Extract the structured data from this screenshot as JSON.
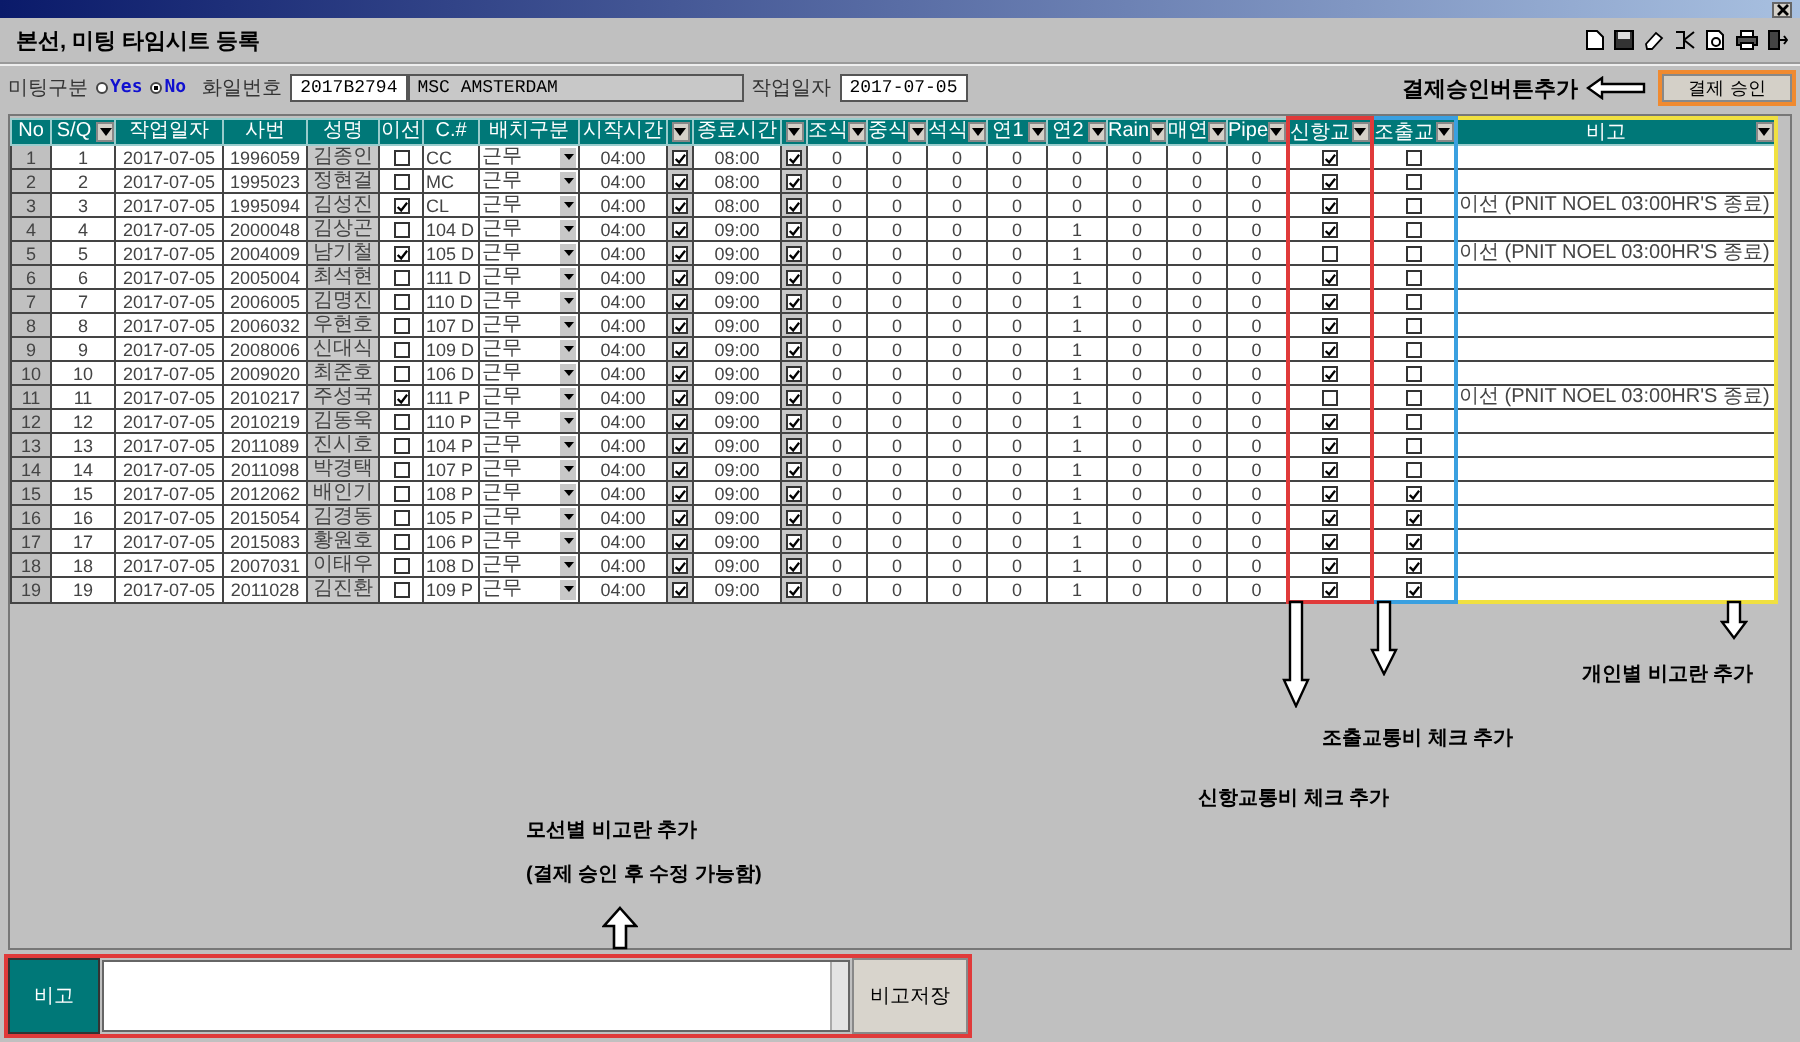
{
  "window": {
    "title": "본선, 미팅 타임시트 등록"
  },
  "form": {
    "meeting_label": "미팅구분",
    "meeting_options": [
      {
        "label": "Yes",
        "selected": false
      },
      {
        "label": "No",
        "selected": true
      }
    ],
    "file_no_label": "화일번호",
    "file_no": "2017B2794",
    "vessel": "MSC AMSTERDAM",
    "work_date_label": "작업일자",
    "work_date": "2017-07-05"
  },
  "approve_note": "결제승인버튼추가",
  "approve_button": {
    "label": "결제 승인"
  },
  "table": {
    "columns": [
      {
        "label": "No",
        "filter": false
      },
      {
        "label": "S/Q",
        "filter": true
      },
      {
        "label": "작업일자",
        "filter": false
      },
      {
        "label": "사번",
        "filter": false
      },
      {
        "label": "성명",
        "filter": false
      },
      {
        "label": "이선",
        "filter": false
      },
      {
        "label": "C.#",
        "filter": false
      },
      {
        "label": "배치구분",
        "filter": false
      },
      {
        "label": "시작시간",
        "filter": false
      },
      {
        "filter": true
      },
      {
        "label": "종료시간",
        "filter": false
      },
      {
        "filter": true
      },
      {
        "label": "조식",
        "filter": true
      },
      {
        "label": "중식",
        "filter": true
      },
      {
        "label": "석식",
        "filter": true
      },
      {
        "label": "연1",
        "filter": true
      },
      {
        "label": "연2",
        "filter": true
      },
      {
        "label": "Rain",
        "filter": true
      },
      {
        "label": "매연",
        "filter": true
      },
      {
        "label": "Pipe",
        "filter": true
      },
      {
        "label": "신항교",
        "filter": true,
        "color": "#e03a3a"
      },
      {
        "label": "조출교",
        "filter": true,
        "color": "#3aa0e0"
      },
      {
        "label": "비고",
        "filter": true,
        "color": "#f0e040"
      }
    ],
    "rows": [
      {
        "no": "1",
        "sq": "1",
        "date": "2017-07-05",
        "emp": "1996059",
        "name": "김종인",
        "isun": false,
        "cno": "CC",
        "assign": "근무",
        "start": "04:00",
        "start_checked": true,
        "end": "08:00",
        "end_checked": true,
        "counts": [
          "0",
          "0",
          "0",
          "0",
          "0",
          "0",
          "0",
          "0"
        ],
        "shinhang": true,
        "jochul": false
      },
      {
        "no": "2",
        "sq": "2",
        "date": "2017-07-05",
        "emp": "1995023",
        "name": "정현걸",
        "isun": false,
        "cno": "MC",
        "assign": "근무",
        "start": "04:00",
        "start_checked": true,
        "end": "08:00",
        "end_checked": true,
        "counts": [
          "0",
          "0",
          "0",
          "0",
          "0",
          "0",
          "0",
          "0"
        ],
        "shinhang": true,
        "jochul": false
      },
      {
        "no": "3",
        "sq": "3",
        "date": "2017-07-05",
        "emp": "1995094",
        "name": "김성진",
        "isun": true,
        "cno": "CL",
        "assign": "근무",
        "start": "04:00",
        "start_checked": true,
        "end": "08:00",
        "end_checked": true,
        "counts": [
          "0",
          "0",
          "0",
          "0",
          "0",
          "0",
          "0",
          "0"
        ],
        "shinhang": true,
        "jochul": false,
        "note": "이선 (PNIT NOEL 03:00HR'S 종료)"
      },
      {
        "no": "4",
        "sq": "4",
        "date": "2017-07-05",
        "emp": "2000048",
        "name": "김상곤",
        "isun": false,
        "cno": "104 D",
        "assign": "근무",
        "start": "04:00",
        "start_checked": true,
        "end": "09:00",
        "end_checked": true,
        "counts": [
          "0",
          "0",
          "0",
          "0",
          "1",
          "0",
          "0",
          "0"
        ],
        "shinhang": true,
        "jochul": false
      },
      {
        "no": "5",
        "sq": "5",
        "date": "2017-07-05",
        "emp": "2004009",
        "name": "남기철",
        "isun": true,
        "cno": "105 D",
        "assign": "근무",
        "start": "04:00",
        "start_checked": true,
        "end": "09:00",
        "end_checked": true,
        "counts": [
          "0",
          "0",
          "0",
          "0",
          "1",
          "0",
          "0",
          "0"
        ],
        "shinhang": false,
        "jochul": false,
        "note": "이선 (PNIT NOEL 03:00HR'S 종료)"
      },
      {
        "no": "6",
        "sq": "6",
        "date": "2017-07-05",
        "emp": "2005004",
        "name": "최석현",
        "isun": false,
        "cno": "111 D",
        "assign": "근무",
        "start": "04:00",
        "start_checked": true,
        "end": "09:00",
        "end_checked": true,
        "counts": [
          "0",
          "0",
          "0",
          "0",
          "1",
          "0",
          "0",
          "0"
        ],
        "shinhang": true,
        "jochul": false
      },
      {
        "no": "7",
        "sq": "7",
        "date": "2017-07-05",
        "emp": "2006005",
        "name": "김명진",
        "isun": false,
        "cno": "110 D",
        "assign": "근무",
        "start": "04:00",
        "start_checked": true,
        "end": "09:00",
        "end_checked": true,
        "counts": [
          "0",
          "0",
          "0",
          "0",
          "1",
          "0",
          "0",
          "0"
        ],
        "shinhang": true,
        "jochul": false
      },
      {
        "no": "8",
        "sq": "8",
        "date": "2017-07-05",
        "emp": "2006032",
        "name": "우현호",
        "isun": false,
        "cno": "107 D",
        "assign": "근무",
        "start": "04:00",
        "start_checked": true,
        "end": "09:00",
        "end_checked": true,
        "counts": [
          "0",
          "0",
          "0",
          "0",
          "1",
          "0",
          "0",
          "0"
        ],
        "shinhang": true,
        "jochul": false
      },
      {
        "no": "9",
        "sq": "9",
        "date": "2017-07-05",
        "emp": "2008006",
        "name": "신대식",
        "isun": false,
        "cno": "109 D",
        "assign": "근무",
        "start": "04:00",
        "start_checked": true,
        "end": "09:00",
        "end_checked": true,
        "counts": [
          "0",
          "0",
          "0",
          "0",
          "1",
          "0",
          "0",
          "0"
        ],
        "shinhang": true,
        "jochul": false
      },
      {
        "no": "10",
        "sq": "10",
        "date": "2017-07-05",
        "emp": "2009020",
        "name": "최준호",
        "isun": false,
        "cno": "106 D",
        "assign": "근무",
        "start": "04:00",
        "start_checked": true,
        "end": "09:00",
        "end_checked": true,
        "counts": [
          "0",
          "0",
          "0",
          "0",
          "1",
          "0",
          "0",
          "0"
        ],
        "shinhang": true,
        "jochul": false
      },
      {
        "no": "11",
        "sq": "11",
        "date": "2017-07-05",
        "emp": "2010217",
        "name": "주성국",
        "isun": true,
        "cno": "111 P",
        "assign": "근무",
        "start": "04:00",
        "start_checked": true,
        "end": "09:00",
        "end_checked": true,
        "counts": [
          "0",
          "0",
          "0",
          "0",
          "1",
          "0",
          "0",
          "0"
        ],
        "shinhang": false,
        "jochul": false,
        "note": "이선 (PNIT NOEL 03:00HR'S 종료)"
      },
      {
        "no": "12",
        "sq": "12",
        "date": "2017-07-05",
        "emp": "2010219",
        "name": "김동욱",
        "isun": false,
        "cno": "110 P",
        "assign": "근무",
        "start": "04:00",
        "start_checked": true,
        "end": "09:00",
        "end_checked": true,
        "counts": [
          "0",
          "0",
          "0",
          "0",
          "1",
          "0",
          "0",
          "0"
        ],
        "shinhang": true,
        "jochul": false
      },
      {
        "no": "13",
        "sq": "13",
        "date": "2017-07-05",
        "emp": "2011089",
        "name": "진시호",
        "isun": false,
        "cno": "104 P",
        "assign": "근무",
        "start": "04:00",
        "start_checked": true,
        "end": "09:00",
        "end_checked": true,
        "counts": [
          "0",
          "0",
          "0",
          "0",
          "1",
          "0",
          "0",
          "0"
        ],
        "shinhang": true,
        "jochul": false
      },
      {
        "no": "14",
        "sq": "14",
        "date": "2017-07-05",
        "emp": "2011098",
        "name": "박경택",
        "isun": false,
        "cno": "107 P",
        "assign": "근무",
        "start": "04:00",
        "start_checked": true,
        "end": "09:00",
        "end_checked": true,
        "counts": [
          "0",
          "0",
          "0",
          "0",
          "1",
          "0",
          "0",
          "0"
        ],
        "shinhang": true,
        "jochul": false
      },
      {
        "no": "15",
        "sq": "15",
        "date": "2017-07-05",
        "emp": "2012062",
        "name": "배인기",
        "isun": false,
        "cno": "108 P",
        "assign": "근무",
        "start": "04:00",
        "start_checked": true,
        "end": "09:00",
        "end_checked": true,
        "counts": [
          "0",
          "0",
          "0",
          "0",
          "1",
          "0",
          "0",
          "0"
        ],
        "shinhang": true,
        "jochul": true
      },
      {
        "no": "16",
        "sq": "16",
        "date": "2017-07-05",
        "emp": "2015054",
        "name": "김경동",
        "isun": false,
        "cno": "105 P",
        "assign": "근무",
        "start": "04:00",
        "start_checked": true,
        "end": "09:00",
        "end_checked": true,
        "counts": [
          "0",
          "0",
          "0",
          "0",
          "1",
          "0",
          "0",
          "0"
        ],
        "shinhang": true,
        "jochul": true
      },
      {
        "no": "17",
        "sq": "17",
        "date": "2017-07-05",
        "emp": "2015083",
        "name": "황원호",
        "isun": false,
        "cno": "106 P",
        "assign": "근무",
        "start": "04:00",
        "start_checked": true,
        "end": "09:00",
        "end_checked": true,
        "counts": [
          "0",
          "0",
          "0",
          "0",
          "1",
          "0",
          "0",
          "0"
        ],
        "shinhang": true,
        "jochul": true
      },
      {
        "no": "18",
        "sq": "18",
        "date": "2017-07-05",
        "emp": "2007031",
        "name": "이태우",
        "isun": false,
        "cno": "108 D",
        "assign": "근무",
        "start": "04:00",
        "start_checked": true,
        "end": "09:00",
        "end_checked": true,
        "counts": [
          "0",
          "0",
          "0",
          "0",
          "1",
          "0",
          "0",
          "0"
        ],
        "shinhang": true,
        "jochul": true
      },
      {
        "no": "19",
        "sq": "19",
        "date": "2017-07-05",
        "emp": "2011028",
        "name": "김진환",
        "isun": false,
        "cno": "109 P",
        "assign": "근무",
        "start": "04:00",
        "start_checked": true,
        "end": "09:00",
        "end_checked": true,
        "counts": [
          "0",
          "0",
          "0",
          "0",
          "1",
          "0",
          "0",
          "0"
        ],
        "shinhang": true,
        "jochul": true
      }
    ]
  },
  "notes": {
    "personal_remarks": "개인별 비고란 추가",
    "early_commute": "조출교통비 체크 추가",
    "newport_commute": "신항교통비 체크 추가",
    "vessel_remarks": "모선별 비고란 추가",
    "vessel_remarks_sub": "(결제 승인 후 수정 가능함)"
  },
  "remarks_panel": {
    "label": "비고",
    "save_button": "비고저장"
  }
}
